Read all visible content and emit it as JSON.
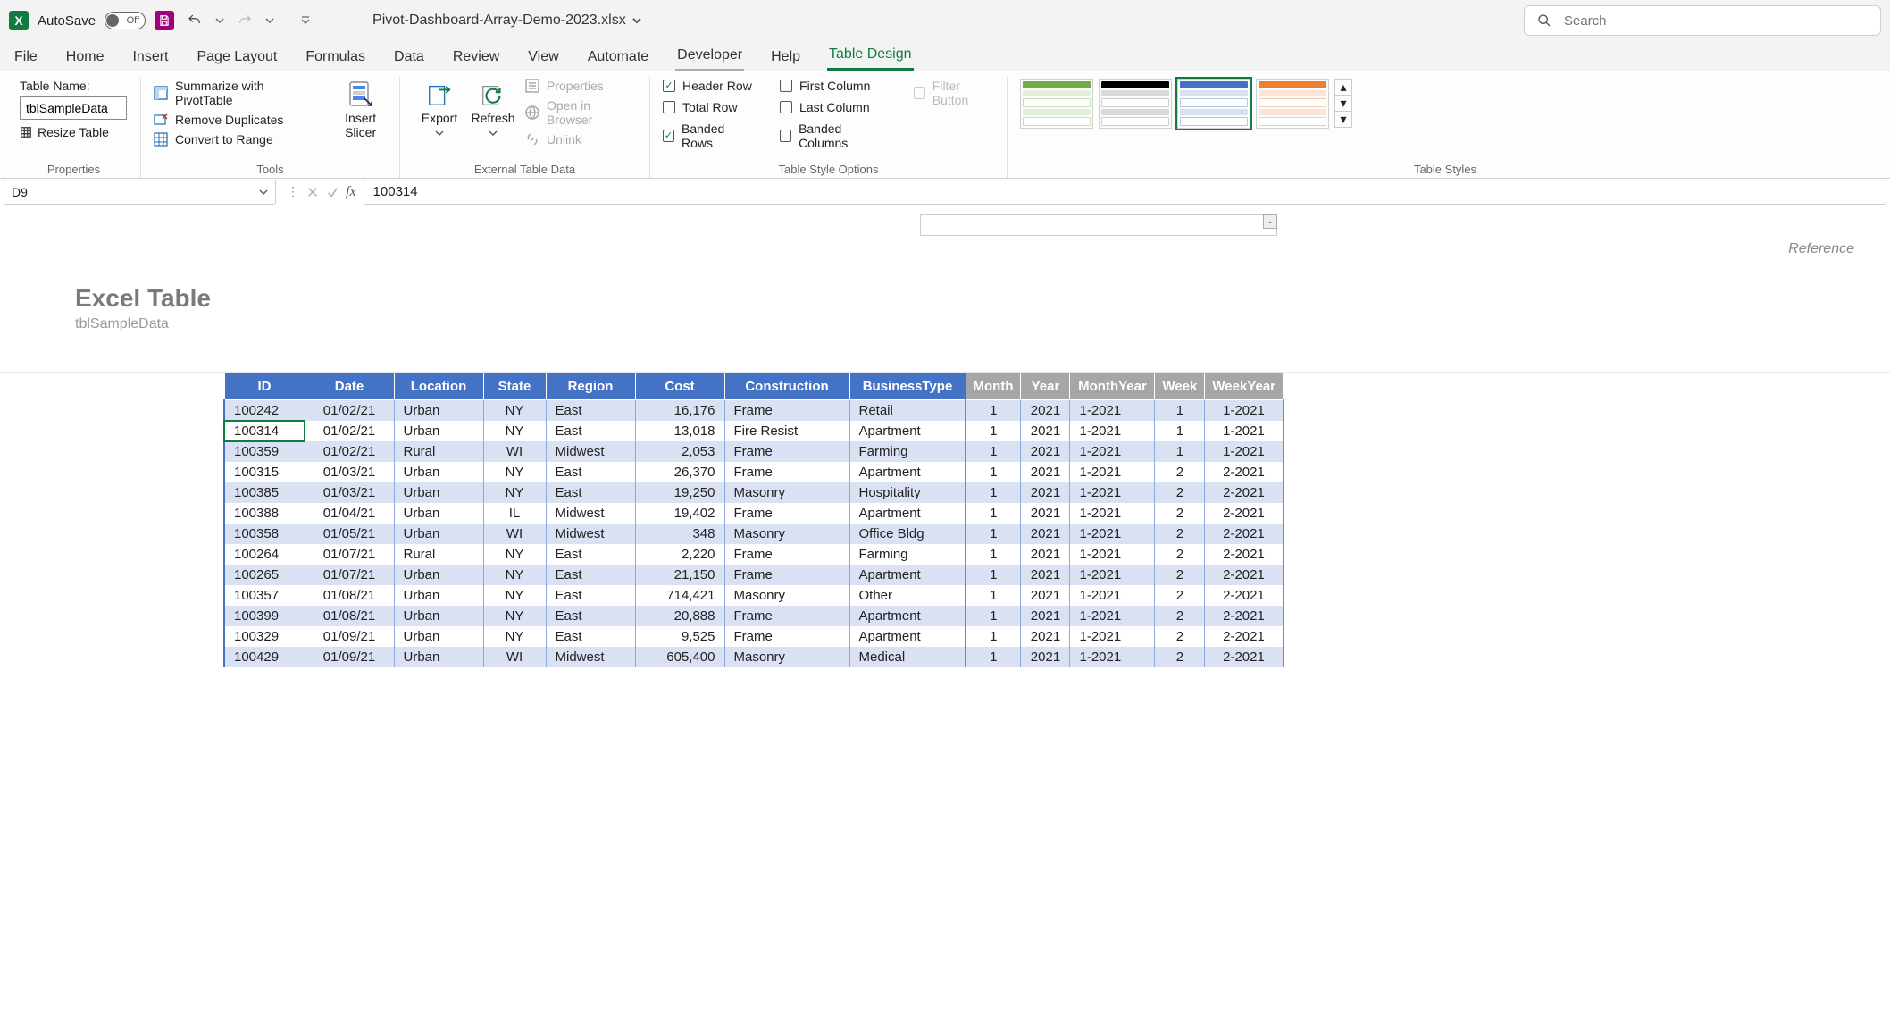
{
  "titlebar": {
    "autosave_label": "AutoSave",
    "autosave_state": "Off",
    "filename": "Pivot-Dashboard-Array-Demo-2023.xlsx",
    "search_placeholder": "Search"
  },
  "tabs": [
    "File",
    "Home",
    "Insert",
    "Page Layout",
    "Formulas",
    "Data",
    "Review",
    "View",
    "Automate",
    "Developer",
    "Help",
    "Table Design"
  ],
  "active_tab": "Table Design",
  "ribbon": {
    "properties": {
      "label": "Properties",
      "name_label": "Table Name:",
      "name_value": "tblSampleData",
      "resize": "Resize Table"
    },
    "tools": {
      "label": "Tools",
      "summarize": "Summarize with PivotTable",
      "dedupe": "Remove Duplicates",
      "convert": "Convert to Range",
      "slicer": "Insert\nSlicer"
    },
    "external": {
      "label": "External Table Data",
      "export": "Export",
      "refresh": "Refresh",
      "properties": "Properties",
      "browser": "Open in Browser",
      "unlink": "Unlink"
    },
    "options": {
      "label": "Table Style Options",
      "header_row": "Header Row",
      "total_row": "Total Row",
      "banded_rows": "Banded Rows",
      "first_col": "First Column",
      "last_col": "Last Column",
      "banded_cols": "Banded Columns",
      "filter_btn": "Filter Button"
    },
    "styles": {
      "label": "Table Styles"
    }
  },
  "formula_bar": {
    "cell_ref": "D9",
    "formula": "100314"
  },
  "sheet": {
    "reference_label": "Reference",
    "title": "Excel Table",
    "subtitle": "tblSampleData"
  },
  "table": {
    "headers_main": [
      "ID",
      "Date",
      "Location",
      "State",
      "Region",
      "Cost",
      "Construction",
      "BusinessType"
    ],
    "headers_grey": [
      "Month",
      "Year",
      "MonthYear",
      "Week",
      "WeekYear"
    ],
    "rows": [
      {
        "id": "100242",
        "date": "01/02/21",
        "loc": "Urban",
        "state": "NY",
        "region": "East",
        "cost": "16,176",
        "constr": "Frame",
        "biz": "Retail",
        "month": "1",
        "year": "2021",
        "my": "1-2021",
        "week": "1",
        "wy": "1-2021"
      },
      {
        "id": "100314",
        "date": "01/02/21",
        "loc": "Urban",
        "state": "NY",
        "region": "East",
        "cost": "13,018",
        "constr": "Fire Resist",
        "biz": "Apartment",
        "month": "1",
        "year": "2021",
        "my": "1-2021",
        "week": "1",
        "wy": "1-2021",
        "selected": true
      },
      {
        "id": "100359",
        "date": "01/02/21",
        "loc": "Rural",
        "state": "WI",
        "region": "Midwest",
        "cost": "2,053",
        "constr": "Frame",
        "biz": "Farming",
        "month": "1",
        "year": "2021",
        "my": "1-2021",
        "week": "1",
        "wy": "1-2021"
      },
      {
        "id": "100315",
        "date": "01/03/21",
        "loc": "Urban",
        "state": "NY",
        "region": "East",
        "cost": "26,370",
        "constr": "Frame",
        "biz": "Apartment",
        "month": "1",
        "year": "2021",
        "my": "1-2021",
        "week": "2",
        "wy": "2-2021"
      },
      {
        "id": "100385",
        "date": "01/03/21",
        "loc": "Urban",
        "state": "NY",
        "region": "East",
        "cost": "19,250",
        "constr": "Masonry",
        "biz": "Hospitality",
        "month": "1",
        "year": "2021",
        "my": "1-2021",
        "week": "2",
        "wy": "2-2021"
      },
      {
        "id": "100388",
        "date": "01/04/21",
        "loc": "Urban",
        "state": "IL",
        "region": "Midwest",
        "cost": "19,402",
        "constr": "Frame",
        "biz": "Apartment",
        "month": "1",
        "year": "2021",
        "my": "1-2021",
        "week": "2",
        "wy": "2-2021"
      },
      {
        "id": "100358",
        "date": "01/05/21",
        "loc": "Urban",
        "state": "WI",
        "region": "Midwest",
        "cost": "348",
        "constr": "Masonry",
        "biz": "Office Bldg",
        "month": "1",
        "year": "2021",
        "my": "1-2021",
        "week": "2",
        "wy": "2-2021"
      },
      {
        "id": "100264",
        "date": "01/07/21",
        "loc": "Rural",
        "state": "NY",
        "region": "East",
        "cost": "2,220",
        "constr": "Frame",
        "biz": "Farming",
        "month": "1",
        "year": "2021",
        "my": "1-2021",
        "week": "2",
        "wy": "2-2021"
      },
      {
        "id": "100265",
        "date": "01/07/21",
        "loc": "Urban",
        "state": "NY",
        "region": "East",
        "cost": "21,150",
        "constr": "Frame",
        "biz": "Apartment",
        "month": "1",
        "year": "2021",
        "my": "1-2021",
        "week": "2",
        "wy": "2-2021"
      },
      {
        "id": "100357",
        "date": "01/08/21",
        "loc": "Urban",
        "state": "NY",
        "region": "East",
        "cost": "714,421",
        "constr": "Masonry",
        "biz": "Other",
        "month": "1",
        "year": "2021",
        "my": "1-2021",
        "week": "2",
        "wy": "2-2021"
      },
      {
        "id": "100399",
        "date": "01/08/21",
        "loc": "Urban",
        "state": "NY",
        "region": "East",
        "cost": "20,888",
        "constr": "Frame",
        "biz": "Apartment",
        "month": "1",
        "year": "2021",
        "my": "1-2021",
        "week": "2",
        "wy": "2-2021"
      },
      {
        "id": "100329",
        "date": "01/09/21",
        "loc": "Urban",
        "state": "NY",
        "region": "East",
        "cost": "9,525",
        "constr": "Frame",
        "biz": "Apartment",
        "month": "1",
        "year": "2021",
        "my": "1-2021",
        "week": "2",
        "wy": "2-2021"
      },
      {
        "id": "100429",
        "date": "01/09/21",
        "loc": "Urban",
        "state": "WI",
        "region": "Midwest",
        "cost": "605,400",
        "constr": "Masonry",
        "biz": "Medical",
        "month": "1",
        "year": "2021",
        "my": "1-2021",
        "week": "2",
        "wy": "2-2021"
      }
    ]
  }
}
